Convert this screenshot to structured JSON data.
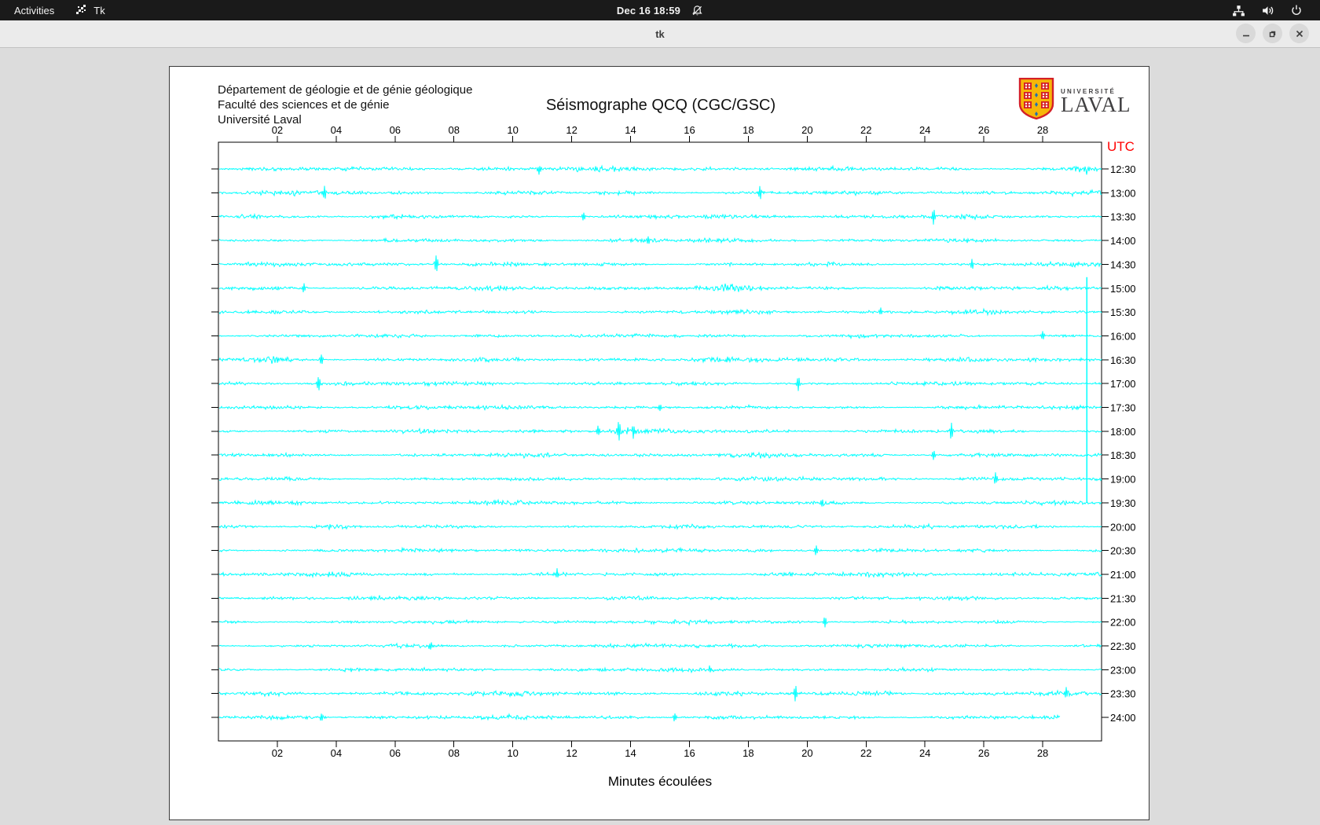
{
  "top_bar": {
    "activities_label": "Activities",
    "app_indicator": "Tk",
    "clock": "Dec 16 18:59"
  },
  "window": {
    "title": "tk"
  },
  "page": {
    "header_lines": [
      "Département de géologie et de génie géologique",
      "Faculté des sciences et de génie",
      "Université Laval"
    ],
    "title": "Séismographe QCQ (CGC/GSC)",
    "utc_label": "UTC",
    "xlabel": "Minutes écoulées",
    "logo": {
      "line1": "UNIVERSITÉ",
      "line2": "LAVAL"
    }
  },
  "colors": {
    "trace": "#00ffff",
    "utc_label": "#ff0000",
    "axis": "#000000",
    "topbar_bg": "#1a1a1a",
    "titlebar_bg": "#ebebeb",
    "window_bg": "#dcdcdc",
    "logo_gold": "#f7b608",
    "logo_red": "#d42027",
    "logo_blue": "#1f6fb4"
  },
  "chart_data": {
    "type": "line",
    "title": "Séismographe QCQ (CGC/GSC)",
    "xlabel": "Minutes écoulées",
    "x_range_minutes": [
      0,
      30
    ],
    "x_ticks": [
      "02",
      "04",
      "06",
      "08",
      "10",
      "12",
      "14",
      "16",
      "18",
      "20",
      "22",
      "24",
      "26",
      "28"
    ],
    "rows": [
      {
        "utc": "12:30",
        "amp": 2.9,
        "end_minute": 30
      },
      {
        "utc": "13:00",
        "amp": 2.6,
        "end_minute": 30
      },
      {
        "utc": "13:30",
        "amp": 2.5,
        "end_minute": 30
      },
      {
        "utc": "14:00",
        "amp": 2.4,
        "end_minute": 30
      },
      {
        "utc": "14:30",
        "amp": 2.5,
        "end_minute": 30
      },
      {
        "utc": "15:00",
        "amp": 2.8,
        "end_minute": 30
      },
      {
        "utc": "15:30",
        "amp": 2.5,
        "end_minute": 30
      },
      {
        "utc": "16:00",
        "amp": 2.4,
        "end_minute": 30
      },
      {
        "utc": "16:30",
        "amp": 2.9,
        "end_minute": 30
      },
      {
        "utc": "17:00",
        "amp": 2.5,
        "end_minute": 30
      },
      {
        "utc": "17:30",
        "amp": 2.3,
        "end_minute": 30
      },
      {
        "utc": "18:00",
        "amp": 2.6,
        "end_minute": 30
      },
      {
        "utc": "18:30",
        "amp": 2.6,
        "end_minute": 30
      },
      {
        "utc": "19:00",
        "amp": 2.5,
        "end_minute": 30
      },
      {
        "utc": "19:30",
        "amp": 2.6,
        "end_minute": 30
      },
      {
        "utc": "20:00",
        "amp": 2.4,
        "end_minute": 30
      },
      {
        "utc": "20:30",
        "amp": 2.4,
        "end_minute": 30
      },
      {
        "utc": "21:00",
        "amp": 2.6,
        "end_minute": 30
      },
      {
        "utc": "21:30",
        "amp": 2.4,
        "end_minute": 30
      },
      {
        "utc": "22:00",
        "amp": 2.3,
        "end_minute": 30
      },
      {
        "utc": "22:30",
        "amp": 2.5,
        "end_minute": 30
      },
      {
        "utc": "23:00",
        "amp": 2.3,
        "end_minute": 30
      },
      {
        "utc": "23:30",
        "amp": 2.7,
        "end_minute": 30
      },
      {
        "utc": "24:00",
        "amp": 2.5,
        "end_minute": 28.6
      }
    ],
    "spikes": [
      {
        "row": 0,
        "minute": 10.9,
        "amp": 7
      },
      {
        "row": 1,
        "minute": 3.6,
        "amp": 8
      },
      {
        "row": 1,
        "minute": 18.4,
        "amp": 11
      },
      {
        "row": 2,
        "minute": 12.4,
        "amp": 6
      },
      {
        "row": 2,
        "minute": 24.3,
        "amp": 11
      },
      {
        "row": 3,
        "minute": 14.6,
        "amp": 6
      },
      {
        "row": 4,
        "minute": 7.4,
        "amp": 12
      },
      {
        "row": 4,
        "minute": 25.6,
        "amp": 7
      },
      {
        "row": 5,
        "minute": 2.9,
        "amp": 6
      },
      {
        "row": 6,
        "minute": 22.5,
        "amp": 5
      },
      {
        "row": 7,
        "minute": 28.0,
        "amp": 6
      },
      {
        "row": 8,
        "minute": 3.5,
        "amp": 7
      },
      {
        "row": 9,
        "minute": 3.4,
        "amp": 11
      },
      {
        "row": 9,
        "minute": 19.7,
        "amp": 10
      },
      {
        "row": 10,
        "minute": 15.0,
        "amp": 5
      },
      {
        "row": 11,
        "minute": 12.9,
        "amp": 8
      },
      {
        "row": 11,
        "minute": 13.6,
        "amp": 13
      },
      {
        "row": 11,
        "minute": 14.1,
        "amp": 11
      },
      {
        "row": 11,
        "minute": 24.9,
        "amp": 11
      },
      {
        "row": 12,
        "minute": 24.3,
        "amp": 7
      },
      {
        "row": 13,
        "minute": 26.4,
        "amp": 8
      },
      {
        "row": 14,
        "minute": 20.5,
        "amp": 6
      },
      {
        "row": 16,
        "minute": 20.3,
        "amp": 7
      },
      {
        "row": 17,
        "minute": 11.5,
        "amp": 6
      },
      {
        "row": 19,
        "minute": 20.6,
        "amp": 7
      },
      {
        "row": 20,
        "minute": 7.2,
        "amp": 5
      },
      {
        "row": 21,
        "minute": 16.7,
        "amp": 5
      },
      {
        "row": 22,
        "minute": 19.6,
        "amp": 11
      },
      {
        "row": 22,
        "minute": 28.8,
        "amp": 7
      },
      {
        "row": 23,
        "minute": 3.5,
        "amp": 5
      },
      {
        "row": 23,
        "minute": 15.5,
        "amp": 6
      }
    ],
    "bursts": [
      {
        "row": 0,
        "from": 29.0,
        "to": 29.9,
        "amp": 6
      },
      {
        "row": 2,
        "from": 0.5,
        "to": 1.5,
        "amp": 3
      },
      {
        "row": 5,
        "from": 16.5,
        "to": 18.5,
        "amp": 5
      },
      {
        "row": 8,
        "from": 1.2,
        "to": 2.5,
        "amp": 4
      },
      {
        "row": 11,
        "from": 13.2,
        "to": 14.4,
        "amp": 4
      },
      {
        "row": 15,
        "from": 3.0,
        "to": 4.5,
        "amp": 3
      },
      {
        "row": 22,
        "from": 21.5,
        "to": 23.5,
        "amp": 4
      }
    ],
    "clip_event": {
      "x_minute": 29.5,
      "from_utc": "15:00",
      "to_utc": "19:30"
    }
  }
}
